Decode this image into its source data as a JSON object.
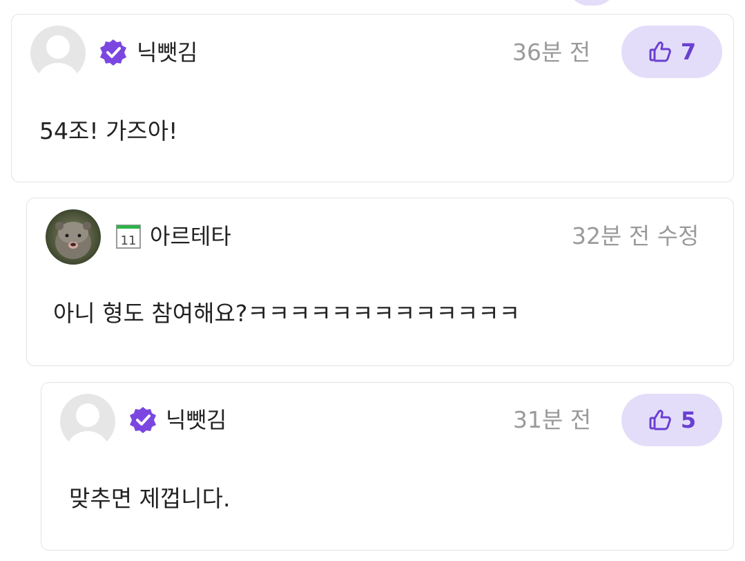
{
  "comments": [
    {
      "author": "닉뺏김",
      "author_badge_icon": "verified-badge-icon",
      "time": "36분 전",
      "likes": "7",
      "text": "54조! 가즈아!"
    },
    {
      "author": "아르테타",
      "author_badge_icon": "calendar-icon",
      "calendar_day": "11",
      "time": "32분 전 수정",
      "text": "아니 형도 참여해요?ㅋㅋㅋㅋㅋㅋㅋㅋㅋㅋㅋㅋㅋ"
    },
    {
      "author": "닉뺏김",
      "author_badge_icon": "verified-badge-icon",
      "time": "31분 전",
      "likes": "5",
      "text": "맞추면 제껍니다."
    }
  ],
  "colors": {
    "accent": "#6a3fd1",
    "like_bg": "#e3ddf9",
    "badge": "#7b47e0",
    "muted_text": "#9a9a9a",
    "card_border": "#e3e3e6"
  }
}
